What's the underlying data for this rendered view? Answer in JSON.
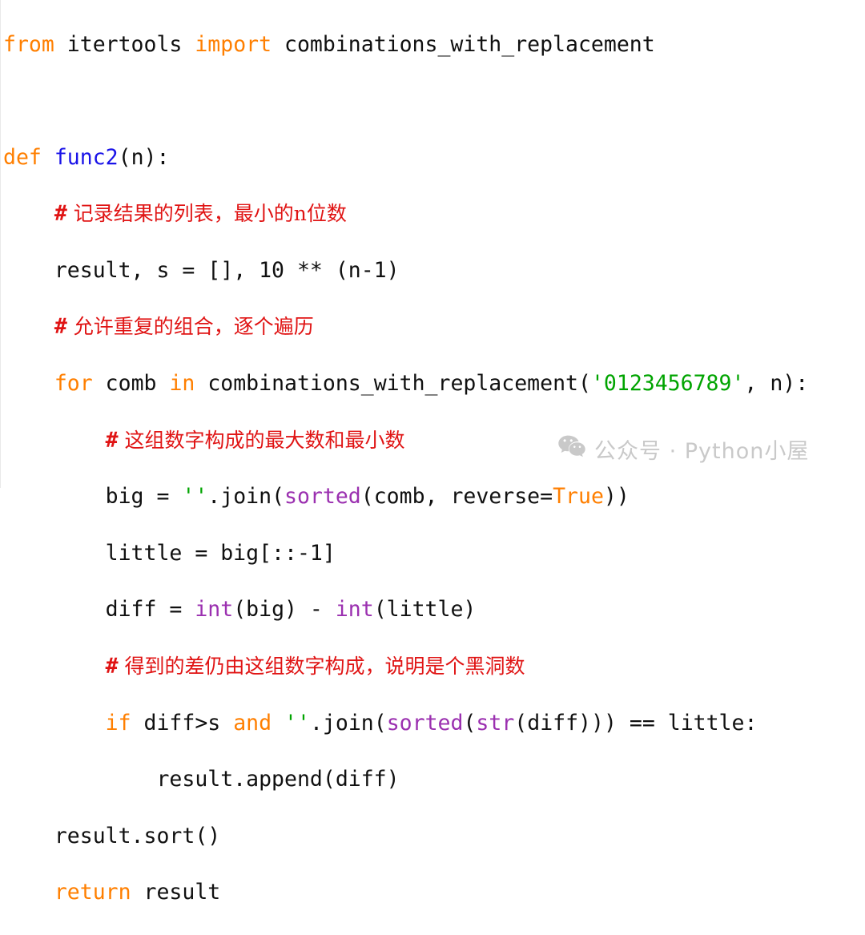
{
  "page": {
    "kind": "code-screenshot",
    "language": "Python",
    "background": "#ffffff"
  },
  "colors": {
    "keyword": "#ff7f00",
    "function_name": "#1a13e8",
    "builtin": "#9b30b0",
    "string": "#00a400",
    "comment": "#e01414",
    "plain_text": "#101010",
    "watermark": "#c9c9c9"
  },
  "code": {
    "lines": [
      {
        "n": 1,
        "indent": "",
        "tokens": [
          {
            "t": "from",
            "c": "kw"
          },
          {
            "t": " itertools ",
            "c": "plain"
          },
          {
            "t": "import",
            "c": "kw"
          },
          {
            "t": " combinations_with_replacement",
            "c": "plain"
          }
        ]
      },
      {
        "n": 2,
        "indent": "",
        "tokens": []
      },
      {
        "n": 3,
        "indent": "",
        "tokens": [
          {
            "t": "def",
            "c": "kw"
          },
          {
            "t": " ",
            "c": "plain"
          },
          {
            "t": "func2",
            "c": "fn"
          },
          {
            "t": "(n):",
            "c": "plain"
          }
        ]
      },
      {
        "n": 4,
        "indent": "    ",
        "tokens": [
          {
            "t": "# 记录结果的列表，最小的n位数",
            "c": "cmt"
          }
        ]
      },
      {
        "n": 5,
        "indent": "    ",
        "tokens": [
          {
            "t": "result, s = [], 10 ** (n-1)",
            "c": "plain"
          }
        ]
      },
      {
        "n": 6,
        "indent": "    ",
        "tokens": [
          {
            "t": "# 允许重复的组合，逐个遍历",
            "c": "cmt"
          }
        ]
      },
      {
        "n": 7,
        "indent": "    ",
        "tokens": [
          {
            "t": "for",
            "c": "kw"
          },
          {
            "t": " comb ",
            "c": "plain"
          },
          {
            "t": "in",
            "c": "kw"
          },
          {
            "t": " combinations_with_replacement(",
            "c": "plain"
          },
          {
            "t": "'0123456789'",
            "c": "str"
          },
          {
            "t": ", n):",
            "c": "plain"
          }
        ]
      },
      {
        "n": 8,
        "indent": "        ",
        "tokens": [
          {
            "t": "# 这组数字构成的最大数和最小数",
            "c": "cmt"
          }
        ]
      },
      {
        "n": 9,
        "indent": "        ",
        "tokens": [
          {
            "t": "big = ",
            "c": "plain"
          },
          {
            "t": "''",
            "c": "str"
          },
          {
            "t": ".join(",
            "c": "plain"
          },
          {
            "t": "sorted",
            "c": "bi"
          },
          {
            "t": "(comb, reverse=",
            "c": "plain"
          },
          {
            "t": "True",
            "c": "kw"
          },
          {
            "t": "))",
            "c": "plain"
          }
        ]
      },
      {
        "n": 10,
        "indent": "        ",
        "tokens": [
          {
            "t": "little = big[::-1]",
            "c": "plain"
          }
        ]
      },
      {
        "n": 11,
        "indent": "        ",
        "tokens": [
          {
            "t": "diff = ",
            "c": "plain"
          },
          {
            "t": "int",
            "c": "bi"
          },
          {
            "t": "(big) - ",
            "c": "plain"
          },
          {
            "t": "int",
            "c": "bi"
          },
          {
            "t": "(little)",
            "c": "plain"
          }
        ]
      },
      {
        "n": 12,
        "indent": "        ",
        "tokens": [
          {
            "t": "# 得到的差仍由这组数字构成，说明是个黑洞数",
            "c": "cmt"
          }
        ]
      },
      {
        "n": 13,
        "indent": "        ",
        "tokens": [
          {
            "t": "if",
            "c": "kw"
          },
          {
            "t": " diff>s ",
            "c": "plain"
          },
          {
            "t": "and",
            "c": "kw"
          },
          {
            "t": " ",
            "c": "plain"
          },
          {
            "t": "''",
            "c": "str"
          },
          {
            "t": ".join(",
            "c": "plain"
          },
          {
            "t": "sorted",
            "c": "bi"
          },
          {
            "t": "(",
            "c": "plain"
          },
          {
            "t": "str",
            "c": "bi"
          },
          {
            "t": "(diff))) == little:",
            "c": "plain"
          }
        ]
      },
      {
        "n": 14,
        "indent": "            ",
        "tokens": [
          {
            "t": "result.append(diff)",
            "c": "plain"
          }
        ]
      },
      {
        "n": 15,
        "indent": "    ",
        "tokens": [
          {
            "t": "result.sort()",
            "c": "plain"
          }
        ]
      },
      {
        "n": 16,
        "indent": "    ",
        "tokens": [
          {
            "t": "return",
            "c": "kw"
          },
          {
            "t": " result",
            "c": "plain"
          }
        ]
      }
    ]
  },
  "watermark": {
    "icon": "wechat-icon",
    "text": "公众号 · Python小屋"
  }
}
